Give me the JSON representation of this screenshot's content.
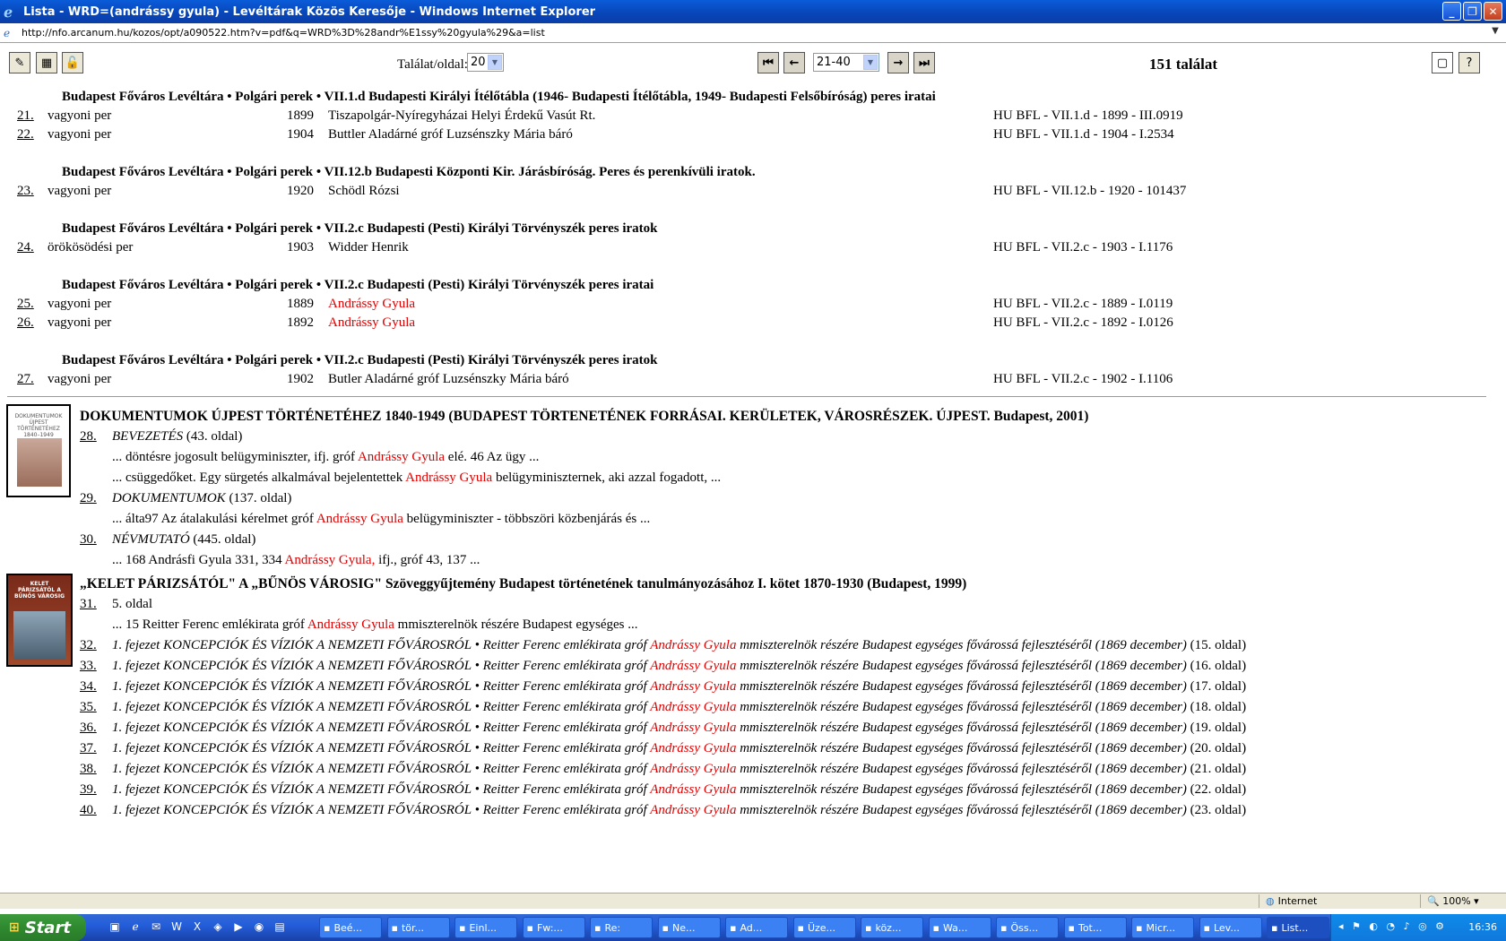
{
  "window": {
    "title": "Lista - WRD=(andrássy gyula) - Levéltárak Közös Keresője - Windows Internet Explorer",
    "url": "http://nfo.arcanum.hu/kozos/opt/a090522.htm?v=pdf&q=WRD%3D%28andr%E1ssy%20gyula%29&a=list"
  },
  "toolbar": {
    "per_page_label": "Találat/oldal:",
    "per_page_value": "20",
    "range_value": "21-40",
    "total": "151 találat"
  },
  "groups": [
    {
      "heading": "Budapest Főváros Levéltára • Polgári perek • VII.1.d Budapesti Királyi Ítélőtábla (1946- Budapesti Ítélőtábla, 1949- Budapesti Felsőbíróság) peres iratai",
      "rows": [
        {
          "num": "21.",
          "type": "vagyoni per",
          "year": "1899",
          "party": "Tiszapolgár-Nyíregyházai Helyi Érdekű Vasút Rt.",
          "ref": "HU BFL - VII.1.d - 1899 - III.0919"
        },
        {
          "num": "22.",
          "type": "vagyoni per",
          "year": "1904",
          "party": "Buttler Aladárné gróf Luzsénszky Mária báró",
          "ref": "HU BFL - VII.1.d - 1904 - I.2534"
        }
      ]
    },
    {
      "heading": "Budapest Főváros Levéltára • Polgári perek • VII.12.b Budapesti Központi Kir. Járásbíróság. Peres és perenkívüli iratok.",
      "rows": [
        {
          "num": "23.",
          "type": "vagyoni per",
          "year": "1920",
          "party": "Schödl Rózsi",
          "ref": "HU BFL - VII.12.b - 1920 - 101437"
        }
      ]
    },
    {
      "heading": "Budapest Főváros Levéltára • Polgári perek • VII.2.c Budapesti (Pesti) Királyi Törvényszék peres iratok",
      "rows": [
        {
          "num": "24.",
          "type": "örökösödési per",
          "year": "1903",
          "party": "Widder Henrik",
          "ref": "HU BFL - VII.2.c - 1903 - I.1176"
        }
      ]
    },
    {
      "heading": "Budapest Főváros Levéltára • Polgári perek • VII.2.c Budapesti (Pesti) Királyi Törvényszék peres iratai",
      "rows": [
        {
          "num": "25.",
          "type": "vagyoni per",
          "year": "1889",
          "party": "Andrássy Gyula",
          "ref": "HU BFL - VII.2.c - 1889 - I.0119"
        },
        {
          "num": "26.",
          "type": "vagyoni per",
          "year": "1892",
          "party": "Andrássy Gyula",
          "ref": "HU BFL - VII.2.c - 1892 - I.0126"
        }
      ]
    },
    {
      "heading": "Budapest Főváros Levéltára • Polgári perek • VII.2.c Budapesti (Pesti) Királyi Törvényszék peres iratok",
      "rows": [
        {
          "num": "27.",
          "type": "vagyoni per",
          "year": "1902",
          "party": "Butler Aladárné gróf Luzsénszky Mária báró",
          "ref": "HU BFL - VII.2.c - 1902 - I.1106"
        }
      ]
    }
  ],
  "book1": {
    "title": "DOKUMENTUMOK ÚJPEST TÖRTÉNETÉHEZ 1840-1949 (BUDAPEST TÖRTENETÉNEK FORRÁSAI. KERÜLETEK, VÁROSRÉSZEK. ÚJPEST. Budapest, 2001)",
    "cover_text": "DOKUMENTUMOK ÚJPEST TÖRTÉNETÉHEZ 1840–1949",
    "entries": [
      {
        "num": "28.",
        "section": "BEVEZETÉS",
        "page": " (43. oldal)"
      },
      {
        "num": "29.",
        "section": "DOKUMENTUMOK",
        "page": " (137. oldal)"
      },
      {
        "num": "30.",
        "section": "NÉVMUTATÓ",
        "page": " (445. oldal)"
      }
    ],
    "snippets": [
      {
        "pre": "... döntésre jogosult belügyminiszter, ifj. gróf ",
        "hl": "Andrássy Gyula",
        "post": " elé. 46 Az ügy ..."
      },
      {
        "pre": "... csüggedőket. Egy sürgetés alkalmával bejelentettek ",
        "hl": "Andrássy Gyula",
        "post": " belügyminiszternek, aki azzal fogadott, ..."
      },
      {
        "pre": "... álta97 Az átalakulási kérelmet gróf ",
        "hl": "Andrássy Gyula",
        "post": " belügyminiszter - többszöri közbenjárás és ..."
      },
      {
        "pre": "... 168 Andrásfi Gyula 331, 334 ",
        "hl": "Andrássy Gyula,",
        "post": " ifj., gróf 43, 137 ..."
      }
    ]
  },
  "book2": {
    "title": "„KELET PÁRIZSÁTÓL\" A „BŰNÖS VÁROSIG\" Szöveggyűjtemény Budapest történetének tanulmányozásához I. kötet 1870-1930 (Budapest, 1999)",
    "cover_text": "KELET PÁRIZSÁTÓL A BŰNÖS VÁROSIG",
    "first": {
      "num": "31.",
      "page": "5. oldal"
    },
    "first_snippet": {
      "pre": "... 15 Reitter Ferenc emlékirata gróf ",
      "hl": "Andrássy Gyula",
      "post": " mmiszterelnök részére Budapest egységes ..."
    },
    "chapter_pre": "1. fejezet KONCEPCIÓK ÉS VÍZIÓK A NEMZETI FŐVÁROSRÓL • Reitter Ferenc emlékirata gróf ",
    "chapter_hl": "Andrássy Gyula",
    "chapter_post": " mmiszterelnök részére Budapest egységes fővárossá fejlesztéséről (1869 december)",
    "chapters": [
      {
        "num": "32.",
        "page": " (15. oldal)"
      },
      {
        "num": "33.",
        "page": " (16. oldal)"
      },
      {
        "num": "34.",
        "page": " (17. oldal)"
      },
      {
        "num": "35.",
        "page": " (18. oldal)"
      },
      {
        "num": "36.",
        "page": " (19. oldal)"
      },
      {
        "num": "37.",
        "page": " (20. oldal)"
      },
      {
        "num": "38.",
        "page": " (21. oldal)"
      },
      {
        "num": "39.",
        "page": " (22. oldal)"
      },
      {
        "num": "40.",
        "page": " (23. oldal)"
      }
    ]
  },
  "statusbar": {
    "zone": "Internet",
    "zoom": "100%"
  },
  "taskbar": {
    "start": "Start",
    "tasks": [
      "Beé...",
      "tör...",
      "Einl...",
      "Fw:...",
      "Re:",
      "Ne...",
      "Ad...",
      "Üze...",
      "köz...",
      "Wa...",
      "Öss...",
      "Tot...",
      "Micr...",
      "Lev...",
      "List..."
    ],
    "clock": "16:36"
  },
  "colors": {
    "highlight": "#e00000",
    "titlebar": "#0a5cd8",
    "taskbar": "#245edb"
  }
}
